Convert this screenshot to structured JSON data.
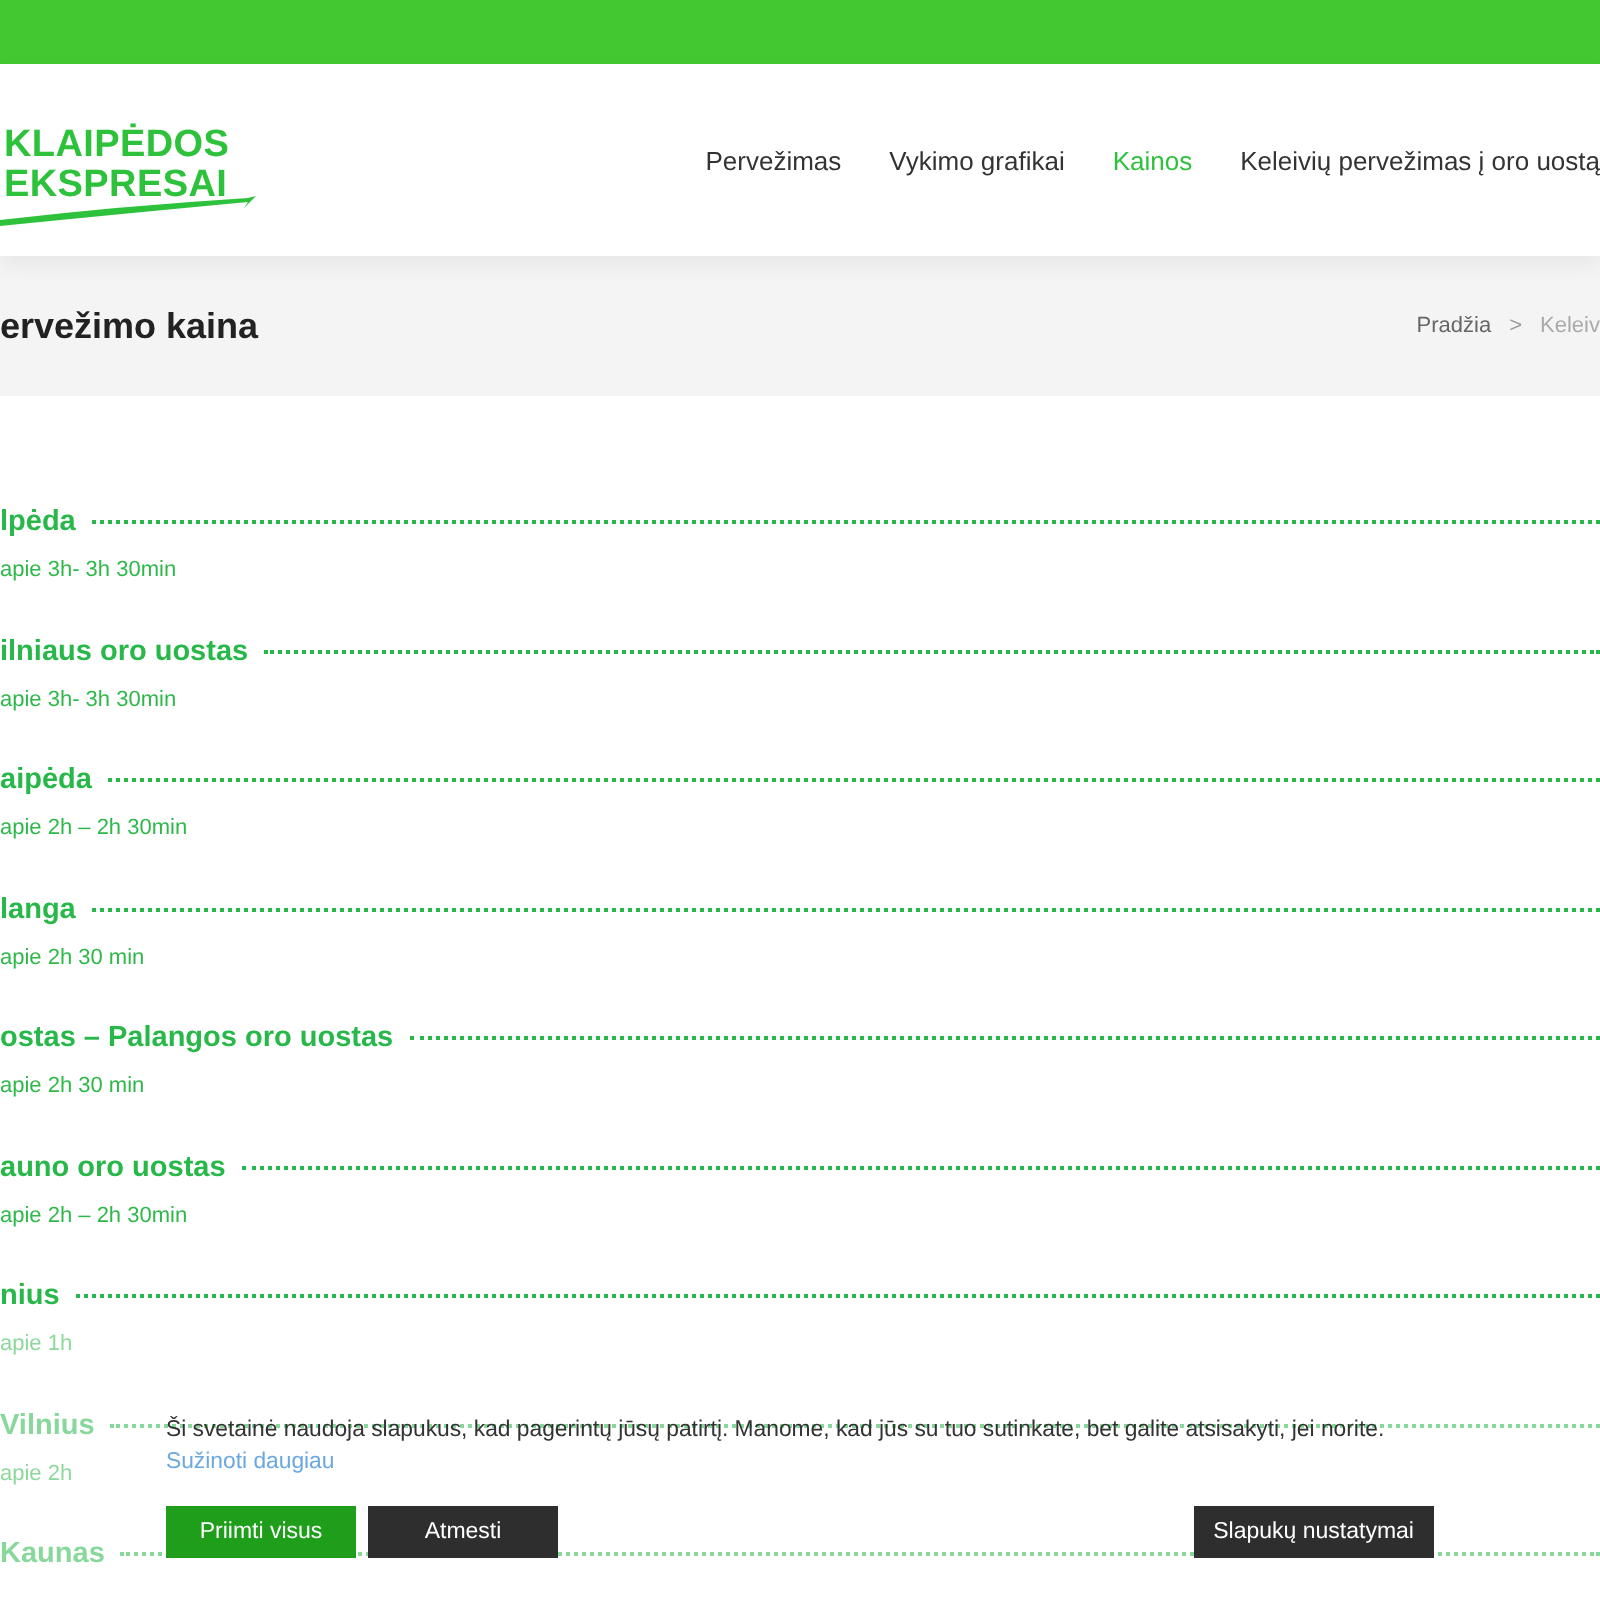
{
  "logo": {
    "line_1": "KLAIPĖDOS",
    "line_2": "EKSPRESAI"
  },
  "nav": [
    {
      "label": "Pervežimas",
      "selected": false
    },
    {
      "label": "Vykimo grafikai",
      "selected": false
    },
    {
      "label": "Kainos",
      "selected": true
    },
    {
      "label": "Keleivių pervežimas į oro uostą",
      "selected": false
    }
  ],
  "page_title": "ervežimo kaina",
  "breadcrumb": {
    "home": "Pradžia",
    "separator": ">",
    "current": "Keleiv"
  },
  "routes": [
    {
      "name": "lpėda",
      "duration": "apie 3h- 3h 30min"
    },
    {
      "name": "ilniaus oro uostas",
      "duration": "apie 3h- 3h 30min"
    },
    {
      "name": "aipėda",
      "duration": "apie 2h – 2h 30min"
    },
    {
      "name": "langa",
      "duration": "apie 2h 30 min"
    },
    {
      "name": "ostas – Palangos oro uostas",
      "duration": "apie 2h 30 min"
    },
    {
      "name": "auno oro uostas",
      "duration": "apie 2h – 2h 30min"
    },
    {
      "name": "nius",
      "duration": "apie 1h"
    },
    {
      "name": "Vilnius",
      "duration": "apie 2h"
    },
    {
      "name": "Kaunas"
    }
  ],
  "cookie_banner": {
    "message": "Ši svetainė naudoja slapukus, kad pagerintų jūsų patirtį. Manome, kad jūs su tuo sutinkate, bet galite atsisakyti, jei norite.",
    "link": "Sužinoti daugiau",
    "buttons": [
      {
        "label": "Priimti visus",
        "kind": "primary"
      },
      {
        "label": "Atmesti",
        "kind": "dark"
      },
      {
        "label": "Slapukų nustatymai",
        "kind": "dark"
      }
    ]
  }
}
